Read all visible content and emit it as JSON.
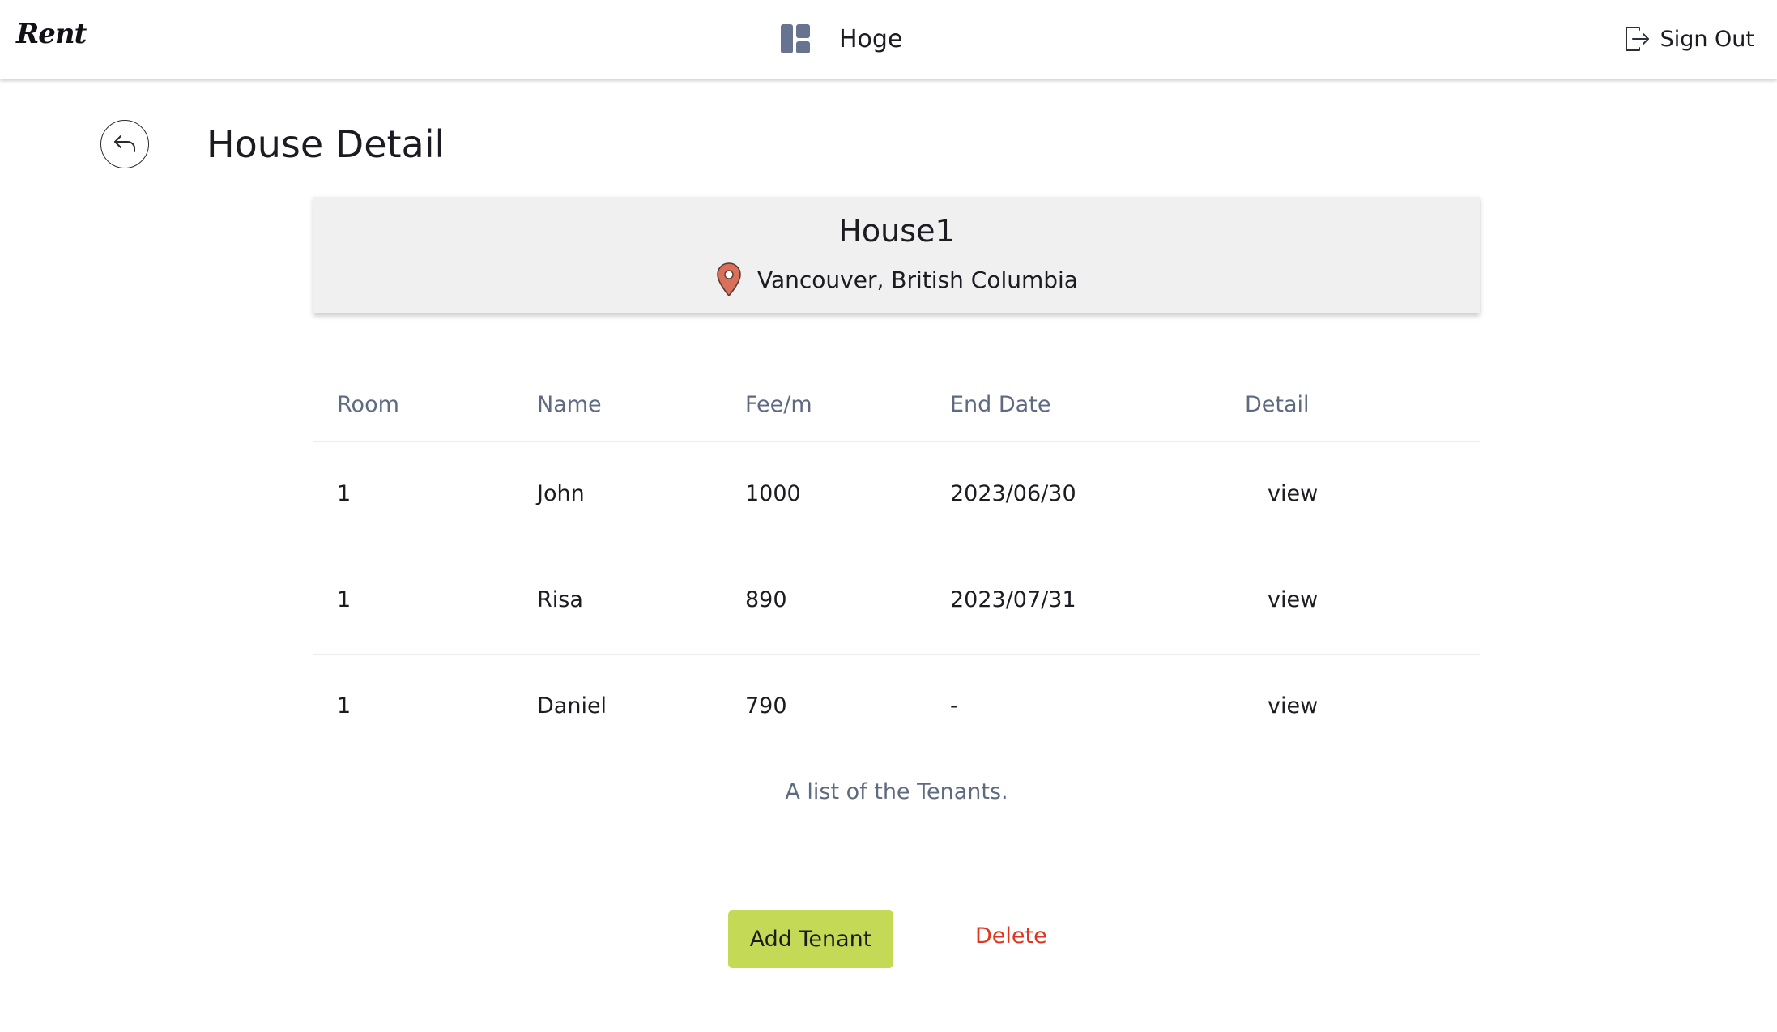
{
  "header": {
    "logo": "Rent",
    "user_name": "Hoge",
    "sign_out_label": "Sign Out",
    "dashboard_icon": "dashboard-icon",
    "sign_out_icon": "logout-icon"
  },
  "page": {
    "title": "House Detail",
    "back_icon": "back-arrow-icon"
  },
  "house": {
    "name": "House1",
    "location": "Vancouver, British Columbia",
    "location_icon": "map-pin-icon"
  },
  "table": {
    "headers": [
      "Room",
      "Name",
      "Fee/m",
      "End Date",
      "Detail"
    ],
    "rows": [
      {
        "room": "1",
        "name": "John",
        "fee": "1000",
        "end_date": "2023/06/30",
        "detail": "view"
      },
      {
        "room": "1",
        "name": "Risa",
        "fee": "890",
        "end_date": "2023/07/31",
        "detail": "view"
      },
      {
        "room": "1",
        "name": "Daniel",
        "fee": "790",
        "end_date": "-",
        "detail": "view"
      }
    ],
    "caption": "A list of the Tenants."
  },
  "actions": {
    "add_tenant_label": "Add Tenant",
    "delete_label": "Delete"
  },
  "colors": {
    "add_button": "#c4da56",
    "delete_text": "#e0341f",
    "card_background": "#f0f0f0",
    "muted_text": "#5e6a80",
    "pin": "#d9705a"
  }
}
